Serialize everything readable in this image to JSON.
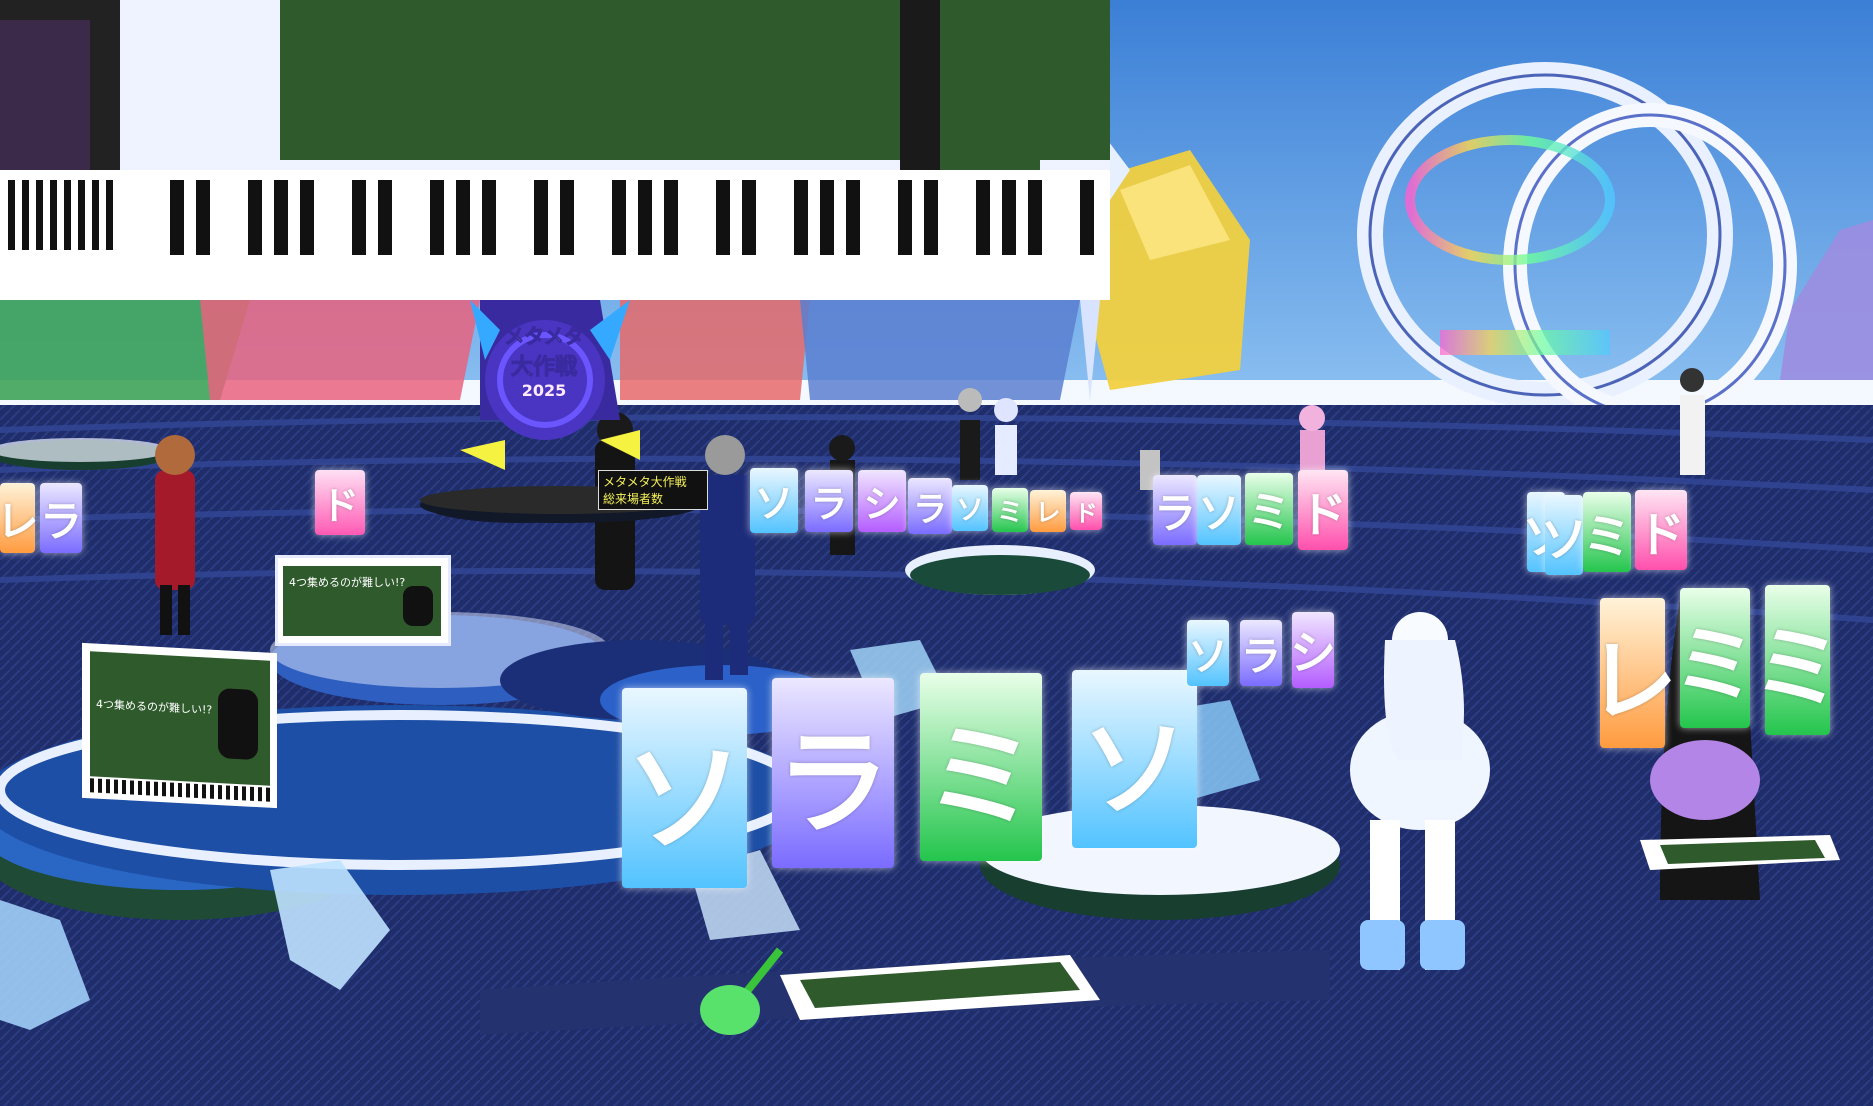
{
  "event_logo": {
    "title_line1": "メタメタ",
    "title_line2": "大作戦",
    "year": "2025"
  },
  "sign": {
    "line1": "メタメタ大作戦",
    "line2": "総来場者数"
  },
  "board_text": {
    "headline": "4つ集めるのが難しい!?"
  },
  "note_cards": {
    "front": [
      "ソ",
      "ラ",
      "ミ",
      "ソ"
    ],
    "back_center": [
      "ソ",
      "ラ",
      "シ",
      "ラ",
      "ソ",
      "ミ",
      "レ",
      "ド"
    ],
    "back_right": [
      "ラ",
      "ソ",
      "ミ",
      "ド"
    ],
    "right_side": [
      "ソ",
      "ソ",
      "ミ",
      "ド"
    ],
    "left": [
      "レ",
      "ラ"
    ],
    "left_single": "ド",
    "mid_row": [
      "ソ",
      "ラ",
      "シ"
    ],
    "far_right": [
      "レ",
      "ミ",
      "ミ"
    ]
  },
  "colors": {
    "sky": "#3f86d9",
    "floor": "#1f2d6b",
    "stage_green": "#2f5a2c",
    "accent_cyan": "#74d7ff"
  }
}
